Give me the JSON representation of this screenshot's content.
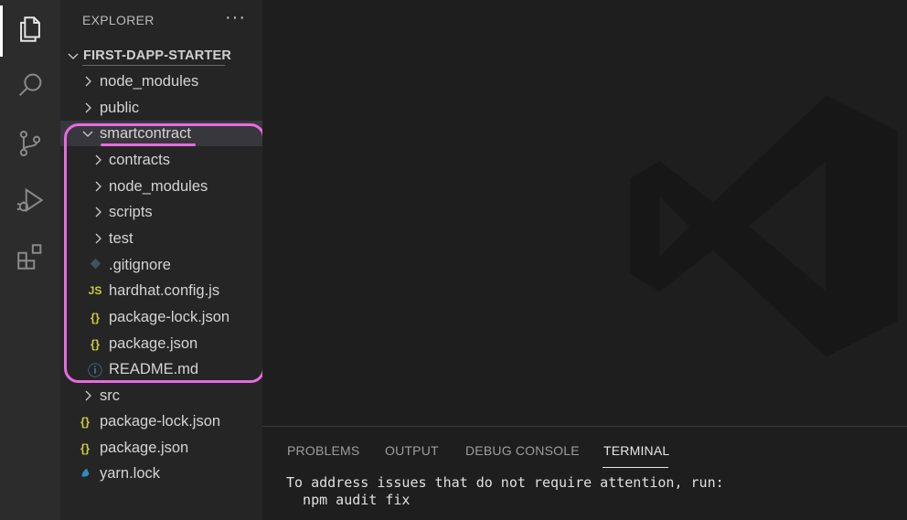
{
  "explorer": {
    "title": "EXPLORER",
    "more_label": "···",
    "root": "FIRST-DAPP-STARTER",
    "items": [
      {
        "label": "node_modules",
        "type": "folder"
      },
      {
        "label": "public",
        "type": "folder"
      },
      {
        "label": "smartcontract",
        "type": "folder-open"
      },
      {
        "label": "contracts",
        "type": "folder"
      },
      {
        "label": "node_modules",
        "type": "folder"
      },
      {
        "label": "scripts",
        "type": "folder"
      },
      {
        "label": "test",
        "type": "folder"
      },
      {
        "label": ".gitignore",
        "type": "git"
      },
      {
        "label": "hardhat.config.js",
        "type": "js",
        "icon_text": "JS"
      },
      {
        "label": "package-lock.json",
        "type": "json",
        "icon_text": "{}"
      },
      {
        "label": "package.json",
        "type": "json",
        "icon_text": "{}"
      },
      {
        "label": "README.md",
        "type": "info",
        "icon_text": "ⓘ"
      },
      {
        "label": "src",
        "type": "folder"
      },
      {
        "label": "package-lock.json",
        "type": "json",
        "icon_text": "{}"
      },
      {
        "label": "package.json",
        "type": "json",
        "icon_text": "{}"
      },
      {
        "label": "yarn.lock",
        "type": "yarn"
      }
    ]
  },
  "panel": {
    "tabs": [
      "PROBLEMS",
      "OUTPUT",
      "DEBUG CONSOLE",
      "TERMINAL"
    ],
    "active_tab": "TERMINAL",
    "terminal_lines": [
      "To address issues that do not require attention, run:",
      "  npm audit fix"
    ]
  },
  "colors": {
    "highlight": "#e86ae0",
    "json_icon": "#cbcb41",
    "js_icon": "#cbcb41",
    "info_icon": "#519aba",
    "git_icon": "#41535b",
    "yarn_icon": "#2c8ebb"
  },
  "icons": [
    "explorer-icon",
    "search-icon",
    "source-control-icon",
    "run-debug-icon",
    "extensions-icon"
  ]
}
